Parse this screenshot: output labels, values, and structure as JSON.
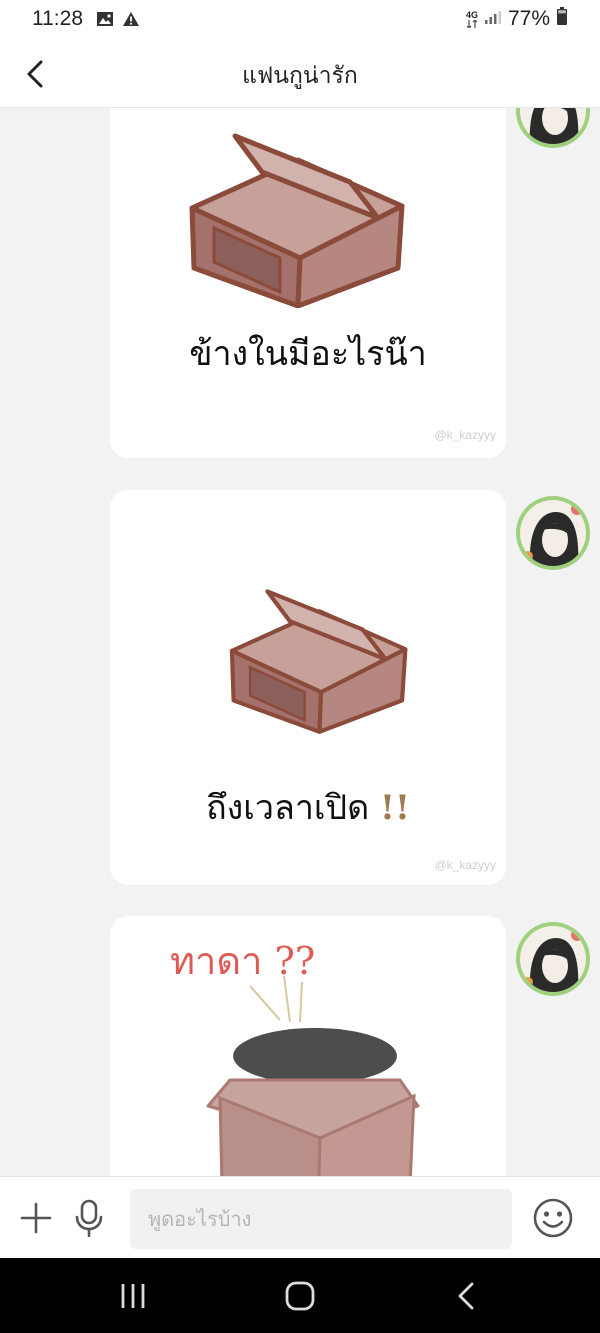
{
  "status_bar": {
    "time": "11:28",
    "network": "4G",
    "battery": "77%",
    "icons": [
      "image-icon",
      "warning-icon",
      "network-icon",
      "signal-icon",
      "battery-icon"
    ]
  },
  "header": {
    "title": "แฟนกูน่ารัก",
    "icons": [
      "back-arrow-icon"
    ]
  },
  "messages": [
    {
      "type": "sticker",
      "caption": "ข้างในมีอะไรน๊า",
      "watermark": "@k_kazyyy"
    },
    {
      "type": "sticker",
      "caption": "ถึงเวลาเปิด",
      "exclaim": "!!",
      "watermark": "@k_kazyyy"
    },
    {
      "type": "sticker",
      "caption": "ทาดา",
      "exclaim": "??"
    }
  ],
  "input_bar": {
    "placeholder": "พูดอะไรบ้าง",
    "icons": [
      "plus-icon",
      "microphone-icon",
      "emoji-icon"
    ]
  },
  "nav_bar": {
    "icons": [
      "recent-apps-icon",
      "home-icon",
      "back-icon"
    ]
  },
  "colors": {
    "background": "#f2f2f2",
    "box_brown": "#a4716c",
    "box_outline": "#8b4b3b",
    "exclaim_brown": "#a07a4e",
    "red_text": "#e05a55",
    "avatar_ring": "#9fd07e"
  }
}
